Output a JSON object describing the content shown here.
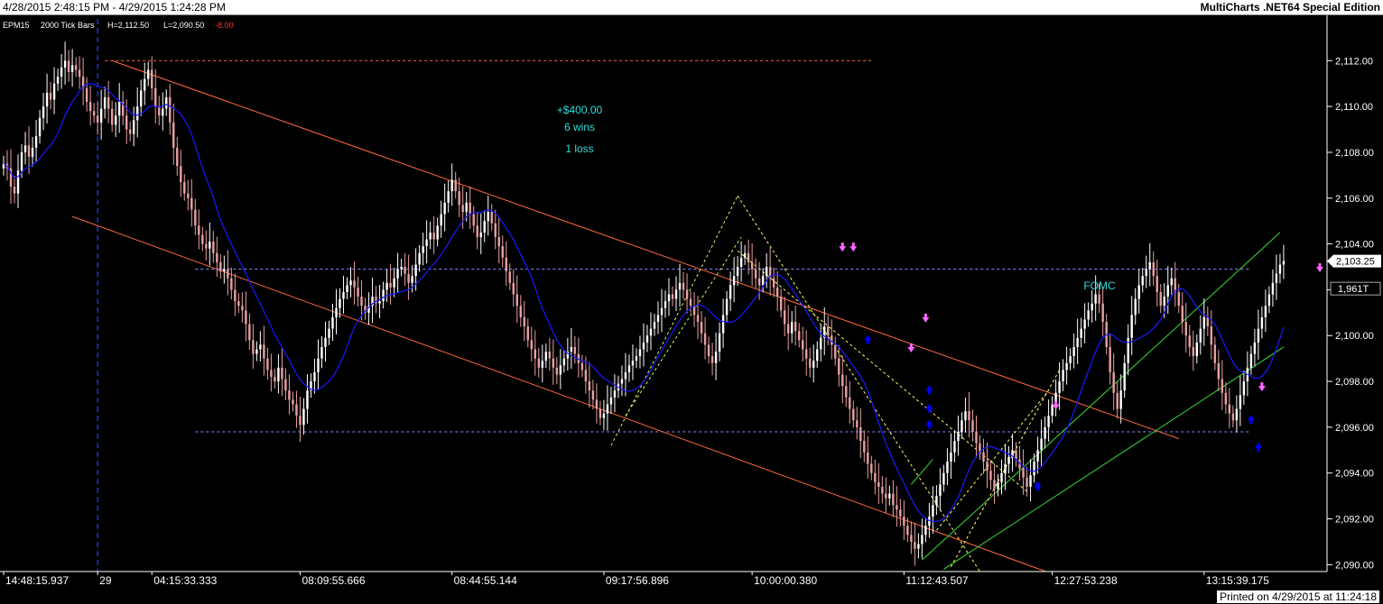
{
  "window": {
    "date_range": "4/28/2015 2:48:15 PM - 4/29/2015 1:24:28 PM",
    "app_title": "MultiCharts .NET64 Special Edition",
    "printed": "Printed on 4/29/2015 at 11:24:18"
  },
  "colors": {
    "background": "#000000",
    "up_bar": "#ffffff",
    "down_bar": "#e8a0a0",
    "moving_average": "#1a1aff",
    "channel_orange": "#ff6a3d",
    "channel_green": "#33dd33",
    "dashed_level": "#8888ff",
    "annotation": "#33dddd",
    "buy_arrow": "#0000ff",
    "sell_arrow": "#ff66ff"
  },
  "chart_data": {
    "type": "candlestick",
    "symbol_label": "EPM15",
    "bar_type_label": "2000 Tick Bars",
    "high_label": "H=2,112.50",
    "low_label": "L=2,090.50",
    "change_label": "-8.00",
    "y_ticks": [
      "2,112.00",
      "2,110.00",
      "2,108.00",
      "2,106.00",
      "2,104.00",
      "2,102.00",
      "2,100.00",
      "2,098.00",
      "2,096.00",
      "2,094.00",
      "2,092.00",
      "2,090.00"
    ],
    "y_tick_values": [
      2112,
      2110,
      2108,
      2106,
      2104,
      2102,
      2100,
      2098,
      2096,
      2094,
      2092,
      2090
    ],
    "ylim": [
      2089.7,
      2113.9
    ],
    "x_ticks": [
      {
        "label": "14:48:15.937",
        "bar": 0
      },
      {
        "label": "29",
        "bar": 26
      },
      {
        "label": "04:15:33.333",
        "bar": 41
      },
      {
        "label": "08:09:55.666",
        "bar": 82
      },
      {
        "label": "08:44:55.144",
        "bar": 124
      },
      {
        "label": "09:17:56.896",
        "bar": 166
      },
      {
        "label": "10:00:00.380",
        "bar": 207
      },
      {
        "label": "11:12:43.507",
        "bar": 249
      },
      {
        "label": "12:27:53.238",
        "bar": 290
      },
      {
        "label": "13:15:39.175",
        "bar": 332
      }
    ],
    "x_range_bars": [
      0,
      365
    ],
    "session_break_bar": 26,
    "last_price_label": "2,103.25",
    "last_price": 2103.25,
    "countdown_label": "1,961T",
    "countdown_price": 2102.6,
    "closes": [
      2107.5,
      2107.3,
      2106.5,
      2106.2,
      2107.2,
      2108.0,
      2108.3,
      2107.8,
      2108.2,
      2108.7,
      2109.5,
      2110.0,
      2110.6,
      2110.3,
      2111.0,
      2111.3,
      2111.7,
      2112.0,
      2111.5,
      2111.8,
      2111.6,
      2111.3,
      2110.8,
      2110.2,
      2109.8,
      2109.6,
      2109.3,
      2109.9,
      2110.4,
      2109.9,
      2109.2,
      2109.6,
      2110.2,
      2109.6,
      2109.0,
      2108.8,
      2109.4,
      2110.0,
      2110.7,
      2111.2,
      2111.6,
      2110.8,
      2110.0,
      2109.6,
      2109.9,
      2110.4,
      2109.3,
      2108.2,
      2107.4,
      2106.7,
      2106.2,
      2106.0,
      2105.5,
      2104.8,
      2104.4,
      2104.0,
      2103.8,
      2104.1,
      2103.6,
      2103.2,
      2102.8,
      2102.9,
      2102.5,
      2102.0,
      2101.5,
      2101.3,
      2101.1,
      2100.5,
      2099.8,
      2099.2,
      2099.4,
      2099.6,
      2099.0,
      2098.5,
      2098.2,
      2098.0,
      2098.6,
      2098.1,
      2097.6,
      2097.2,
      2097.0,
      2096.5,
      2096.1,
      2096.8,
      2097.6,
      2098.0,
      2098.4,
      2099.0,
      2099.5,
      2099.9,
      2100.3,
      2100.8,
      2101.2,
      2101.6,
      2101.9,
      2102.2,
      2102.4,
      2102.1,
      2101.7,
      2101.3,
      2101.0,
      2101.3,
      2101.7,
      2101.4,
      2101.5,
      2102.0,
      2102.3,
      2102.1,
      2102.5,
      2102.9,
      2103.0,
      2102.7,
      2102.3,
      2102.6,
      2103.1,
      2103.6,
      2103.9,
      2104.2,
      2104.5,
      2104.2,
      2104.8,
      2105.3,
      2105.8,
      2106.3,
      2106.8,
      2106.3,
      2105.7,
      2105.4,
      2105.8,
      2105.3,
      2104.8,
      2104.3,
      2104.5,
      2105.0,
      2105.4,
      2104.9,
      2104.3,
      2103.9,
      2103.4,
      2102.8,
      2102.3,
      2101.8,
      2101.3,
      2100.8,
      2100.4,
      2099.8,
      2099.4,
      2099.0,
      2098.6,
      2098.9,
      2099.3,
      2099.0,
      2098.6,
      2098.3,
      2098.7,
      2099.0,
      2099.3,
      2099.5,
      2099.2,
      2098.8,
      2098.5,
      2098.0,
      2097.6,
      2097.2,
      2096.8,
      2096.4,
      2096.6,
      2097.0,
      2097.3,
      2097.6,
      2097.9,
      2098.1,
      2098.4,
      2098.7,
      2098.9,
      2099.1,
      2099.4,
      2099.7,
      2100.0,
      2100.3,
      2100.6,
      2100.9,
      2101.2,
      2101.5,
      2101.8,
      2101.6,
      2102.0,
      2102.3,
      2102.0,
      2101.6,
      2101.3,
      2100.9,
      2100.6,
      2100.1,
      2099.6,
      2099.1,
      2098.8,
      2099.3,
      2100.1,
      2100.9,
      2101.6,
      2102.2,
      2102.6,
      2103.0,
      2103.4,
      2103.6,
      2103.2,
      2102.9,
      2102.5,
      2102.2,
      2102.6,
      2103.0,
      2102.5,
      2102.1,
      2101.7,
      2101.1,
      2100.5,
      2100.1,
      2100.6,
      2100.2,
      2099.8,
      2099.4,
      2099.0,
      2098.6,
      2098.9,
      2099.4,
      2099.9,
      2100.4,
      2100.0,
      2099.6,
      2099.0,
      2098.3,
      2097.8,
      2097.3,
      2096.8,
      2096.3,
      2096.0,
      2095.4,
      2094.9,
      2094.4,
      2094.0,
      2093.6,
      2093.4,
      2093.1,
      2092.9,
      2093.1,
      2092.6,
      2092.4,
      2092.1,
      2091.7,
      2091.3,
      2091.0,
      2090.7,
      2090.9,
      2091.3,
      2091.7,
      2092.1,
      2092.6,
      2093.0,
      2093.5,
      2094.0,
      2094.5,
      2094.9,
      2095.4,
      2095.8,
      2096.3,
      2096.7,
      2096.3,
      2095.8,
      2095.3,
      2094.9,
      2094.5,
      2094.1,
      2093.7,
      2093.3,
      2093.6,
      2094.0,
      2094.4,
      2094.7,
      2095.0,
      2094.6,
      2094.2,
      2093.8,
      2093.4,
      2093.9,
      2094.5,
      2095.0,
      2095.5,
      2096.0,
      2096.5,
      2097.0,
      2097.5,
      2098.0,
      2098.5,
      2098.8,
      2099.1,
      2099.5,
      2099.9,
      2100.3,
      2100.7,
      2101.1,
      2101.4,
      2101.8,
      2101.4,
      2100.6,
      2099.5,
      2098.4,
      2097.5,
      2096.8,
      2097.6,
      2098.8,
      2099.9,
      2100.9,
      2101.6,
      2102.2,
      2102.6,
      2102.9,
      2103.2,
      2102.6,
      2101.9,
      2101.3,
      2101.7,
      2102.2,
      2102.5,
      2101.9,
      2101.3,
      2100.6,
      2100.0,
      2099.5,
      2099.1,
      2099.7,
      2100.3,
      2100.8,
      2100.4,
      2099.6,
      2098.8,
      2098.1,
      2097.5,
      2097.0,
      2096.6,
      2096.3,
      2096.8,
      2097.4,
      2098.0,
      2098.6,
      2099.2,
      2099.7,
      2100.3,
      2100.8,
      2101.3,
      2101.8,
      2102.3,
      2102.7,
      2103.1,
      2103.25
    ]
  },
  "annotations": {
    "profit_label": "+$400.00",
    "wins_label": "6 wins",
    "loss_label": "1 loss",
    "event_label": "FOMC"
  }
}
